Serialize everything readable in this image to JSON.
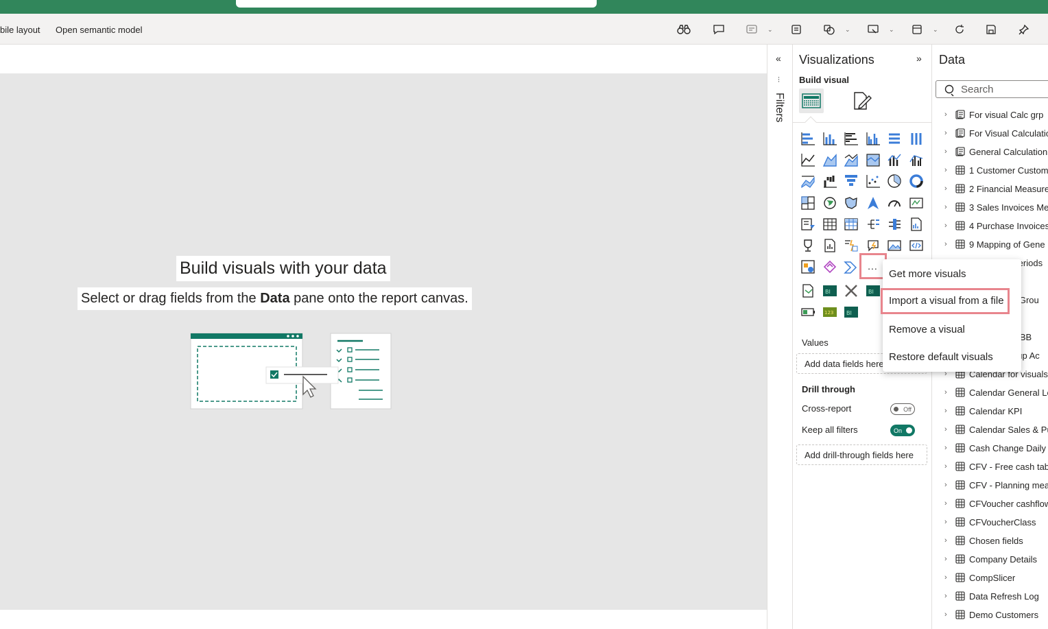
{
  "ribbon": {
    "mobile_layout": "bile layout",
    "open_semantic_model": "Open semantic model"
  },
  "canvas": {
    "title": "Build visuals with your data",
    "subtitle_pre": "Select or drag fields from the ",
    "subtitle_bold": "Data",
    "subtitle_post": " pane onto the report canvas."
  },
  "filters": {
    "label": "Filters"
  },
  "visualizations": {
    "title": "Visualizations",
    "build_visual": "Build visual",
    "more_label": "...",
    "values_label": "Values",
    "values_well": "Add data fields here",
    "drill_through": "Drill through",
    "cross_report": "Cross-report",
    "cross_report_state": "Off",
    "keep_all_filters": "Keep all filters",
    "keep_all_filters_state": "On",
    "drill_well": "Add drill-through fields here"
  },
  "context_menu": {
    "items": [
      "Get more visuals",
      "Import a visual from a file",
      "Remove a visual",
      "Restore default visuals"
    ]
  },
  "data_pane": {
    "title": "Data",
    "search_placeholder": "Search",
    "items": [
      {
        "label": "For visual Calc grp",
        "icon": "calc-group-icon"
      },
      {
        "label": "For Visual Calculatio",
        "icon": "calc-group-icon"
      },
      {
        "label": "General Calculation",
        "icon": "calc-group-icon"
      },
      {
        "label": "1 Customer Custom",
        "icon": "table-icon"
      },
      {
        "label": "2 Financial Measure",
        "icon": "table-icon"
      },
      {
        "label": "3 Sales Invoices Me",
        "icon": "table-icon"
      },
      {
        "label": "4 Purchase Invoices",
        "icon": "table-icon"
      },
      {
        "label": "9 Mapping of Gene",
        "icon": "table-icon"
      },
      {
        "label": "Periods",
        "icon": "table-icon"
      },
      {
        "label": "d Grou",
        "icon": "table-icon"
      },
      {
        "label": "p",
        "icon": "table-icon"
      },
      {
        "label": "p BB",
        "icon": "table-icon"
      },
      {
        "label": "oup Ac",
        "icon": "table-icon"
      },
      {
        "label": "Calendar for visuals",
        "icon": "table-icon"
      },
      {
        "label": "Calendar General Le",
        "icon": "table-icon"
      },
      {
        "label": "Calendar KPI",
        "icon": "table-icon"
      },
      {
        "label": "Calendar Sales & Pu",
        "icon": "table-icon"
      },
      {
        "label": "Cash Change Daily",
        "icon": "table-icon"
      },
      {
        "label": "CFV - Free cash tab",
        "icon": "table-icon"
      },
      {
        "label": "CFV - Planning mea",
        "icon": "table-icon"
      },
      {
        "label": "CFVoucher cashflow",
        "icon": "table-icon"
      },
      {
        "label": "CFVoucherClass",
        "icon": "table-icon"
      },
      {
        "label": "Chosen fields",
        "icon": "table-icon"
      },
      {
        "label": "Company Details",
        "icon": "table-icon"
      },
      {
        "label": "CompSlicer",
        "icon": "table-icon"
      },
      {
        "label": "Data Refresh Log",
        "icon": "table-icon"
      },
      {
        "label": "Demo Customers",
        "icon": "table-icon"
      }
    ]
  },
  "colors": {
    "titlebar": "#31865b",
    "accent_teal": "#117865",
    "highlight": "#e8858d",
    "visual_blue": "#3b7dd8"
  }
}
